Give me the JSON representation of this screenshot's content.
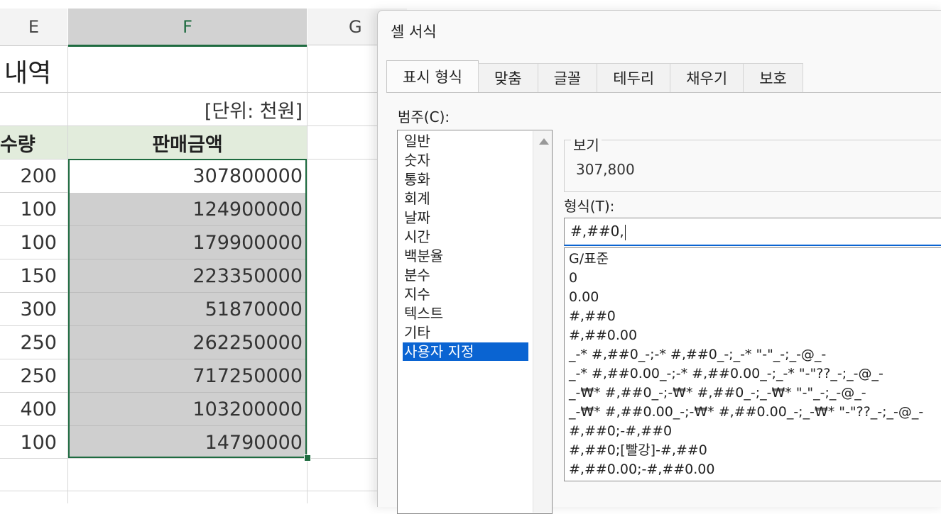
{
  "sheet": {
    "columns": [
      {
        "label": "E",
        "selected": false
      },
      {
        "label": "F",
        "selected": true
      },
      {
        "label": "G",
        "selected": false
      }
    ],
    "title": "내역",
    "unit": "[단위: 천원]",
    "headers": {
      "qty": "수량",
      "amount": "판매금액"
    },
    "rows": [
      {
        "qty": "200",
        "amount": "307800000"
      },
      {
        "qty": "100",
        "amount": "124900000"
      },
      {
        "qty": "100",
        "amount": "179900000"
      },
      {
        "qty": "150",
        "amount": "223350000"
      },
      {
        "qty": "300",
        "amount": "51870000"
      },
      {
        "qty": "250",
        "amount": "262250000"
      },
      {
        "qty": "250",
        "amount": "717250000"
      },
      {
        "qty": "400",
        "amount": "103200000"
      },
      {
        "qty": "100",
        "amount": "14790000"
      }
    ],
    "accent_color": "#1e6b40",
    "header_fill": "#e2ecdc"
  },
  "dialog": {
    "title": "셀 서식",
    "tabs": [
      "표시 형식",
      "맞춤",
      "글꼴",
      "테두리",
      "채우기",
      "보호"
    ],
    "active_tab": "표시 형식",
    "category_label": "범주(C):",
    "categories": [
      "일반",
      "숫자",
      "통화",
      "회계",
      "날짜",
      "시간",
      "백분율",
      "분수",
      "지수",
      "텍스트",
      "기타",
      "사용자 지정"
    ],
    "selected_category": "사용자 지정",
    "preview_label": "보기",
    "preview_value": "307,800",
    "format_label": "형식(T):",
    "format_value": "#,##0,",
    "formats": [
      "G/표준",
      "0",
      "0.00",
      "#,##0",
      "#,##0.00",
      "_-* #,##0_-;-* #,##0_-;_-* \"-\"_-;_-@_-",
      "_-* #,##0.00_-;-* #,##0.00_-;_-* \"-\"??_-;_-@_-",
      "_-₩* #,##0_-;-₩* #,##0_-;_-₩* \"-\"_-;_-@_-",
      "_-₩* #,##0.00_-;-₩* #,##0.00_-;_-₩* \"-\"??_-;_-@_-",
      "#,##0;-#,##0",
      "#,##0;[빨강]-#,##0",
      "#,##0.00;-#,##0.00"
    ],
    "selection_color": "#0a64d2"
  }
}
